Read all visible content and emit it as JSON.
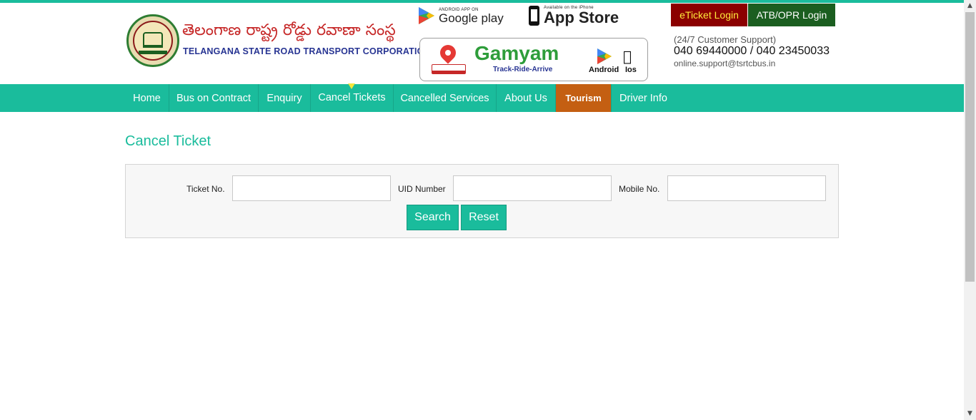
{
  "header": {
    "logo_telugu": "తెలంగాణ రాష్ట్ర రోడ్డు రవాణా సంస్థ",
    "logo_english": "TELANGANA STATE ROAD TRANSPORT CORPORATION",
    "google_play": {
      "small": "ANDROID APP ON",
      "big": "Google play"
    },
    "app_store": {
      "small": "Available on the iPhone",
      "big": "App Store"
    },
    "gamyam": {
      "title": "Gamyam",
      "tagline": "Track-Ride-Arrive",
      "android_label": "Android",
      "ios_label": "Ios"
    },
    "eticket_login": "eTicket Login",
    "atb_login": "ATB/OPR Login",
    "support_label": "(24/7 Customer Support)",
    "support_phones": "040 69440000 / 040 23450033",
    "support_email": "online.support@tsrtcbus.in"
  },
  "nav": {
    "items": [
      {
        "label": "Home"
      },
      {
        "label": "Bus on Contract"
      },
      {
        "label": "Enquiry"
      },
      {
        "label": "Cancel Tickets"
      },
      {
        "label": "Cancelled Services"
      },
      {
        "label": "About Us"
      },
      {
        "label": "Tourism"
      },
      {
        "label": "Driver Info"
      }
    ],
    "active": "Cancel Tickets"
  },
  "main": {
    "title": "Cancel Ticket",
    "fields": [
      {
        "label": "Ticket No.",
        "value": "",
        "placeholder": ""
      },
      {
        "label": "UID Number",
        "value": "",
        "placeholder": ""
      },
      {
        "label": "Mobile No.",
        "value": "",
        "placeholder": ""
      }
    ],
    "search_label": "Search",
    "reset_label": "Reset"
  },
  "colors": {
    "brand_teal": "#1abc9c",
    "eticket_bg": "#8b0000",
    "atb_bg": "#1b5e20",
    "tourism_bg": "#c45f12"
  },
  "icons": [
    "emblem-logo",
    "google-play-icon",
    "phone-icon",
    "location-pin-icon",
    "bus-icon",
    "play-store-icon",
    "apple-icon",
    "nav-caret-icon"
  ]
}
